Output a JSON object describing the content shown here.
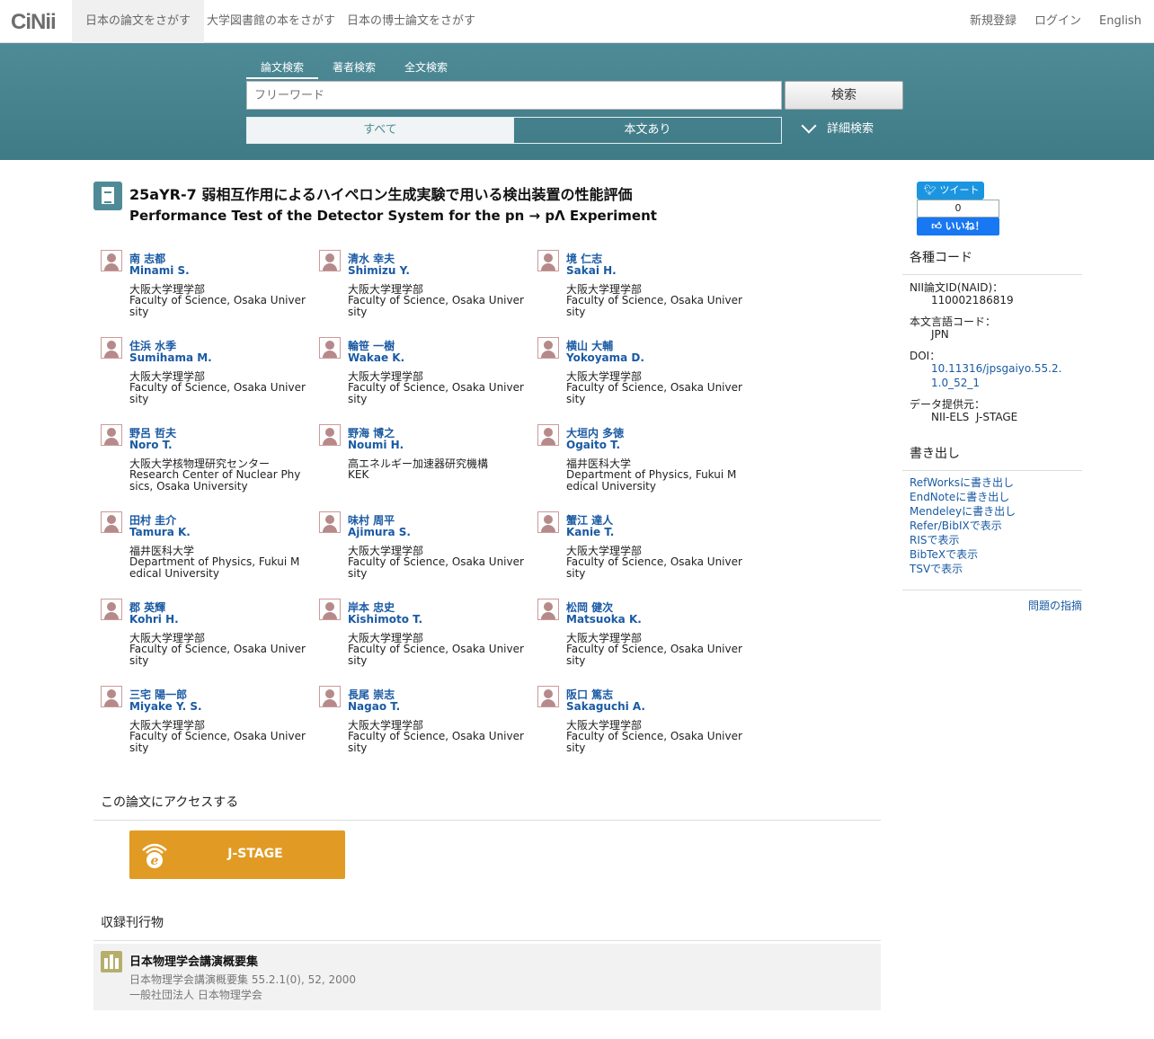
{
  "header": {
    "logo": "CiNii",
    "tabs": [
      "日本の論文をさがす",
      "大学図書館の本をさがす",
      "日本の博士論文をさがす"
    ],
    "register": "新規登録",
    "login": "ログイン",
    "language": "English"
  },
  "search": {
    "tabs": [
      "論文検索",
      "著者検索",
      "全文検索"
    ],
    "placeholder": "フリーワード",
    "button": "検索",
    "filter_all": "すべて",
    "filter_fulltext": "本文あり",
    "advanced": "詳細検索"
  },
  "article": {
    "title_ja": "25aYR-7 弱相互作用によるハイペロン生成実験で用いる検出装置の性能評価",
    "title_en": "Performance Test of the Detector System for the pn → pΛ Experiment"
  },
  "authors": [
    {
      "name": "南 志都",
      "name_en": "Minami S.",
      "aff_ja": "大阪大学理学部",
      "aff_en": "Faculty of Science, Osaka University"
    },
    {
      "name": "清水 幸夫",
      "name_en": "Shimizu Y.",
      "aff_ja": "大阪大学理学部",
      "aff_en": "Faculty of Science, Osaka University"
    },
    {
      "name": "境 仁志",
      "name_en": "Sakai H.",
      "aff_ja": "大阪大学理学部",
      "aff_en": "Faculty of Science, Osaka University"
    },
    {
      "name": "住浜 水季",
      "name_en": "Sumihama M.",
      "aff_ja": "大阪大学理学部",
      "aff_en": "Faculty of Science, Osaka University"
    },
    {
      "name": "輪笹 一樹",
      "name_en": "Wakae K.",
      "aff_ja": "大阪大学理学部",
      "aff_en": "Faculty of Science, Osaka University"
    },
    {
      "name": "横山 大輔",
      "name_en": "Yokoyama D.",
      "aff_ja": "大阪大学理学部",
      "aff_en": "Faculty of Science, Osaka University"
    },
    {
      "name": "野呂 哲夫",
      "name_en": "Noro T.",
      "aff_ja": "大阪大学核物理研究センター",
      "aff_en": "Research Center of Nuclear Physics, Osaka University"
    },
    {
      "name": "野海 博之",
      "name_en": "Noumi H.",
      "aff_ja": "高エネルギー加速器研究機構",
      "aff_en": "KEK"
    },
    {
      "name": "大垣内 多徳",
      "name_en": "Ogaito T.",
      "aff_ja": "福井医科大学",
      "aff_en": "Department of Physics, Fukui Medical University"
    },
    {
      "name": "田村 圭介",
      "name_en": "Tamura K.",
      "aff_ja": "福井医科大学",
      "aff_en": "Department of Physics, Fukui Medical University"
    },
    {
      "name": "味村 周平",
      "name_en": "Ajimura S.",
      "aff_ja": "大阪大学理学部",
      "aff_en": "Faculty of Science, Osaka University"
    },
    {
      "name": "蟹江 達人",
      "name_en": "Kanie T.",
      "aff_ja": "大阪大学理学部",
      "aff_en": "Faculty of Science, Osaka University"
    },
    {
      "name": "郡 英輝",
      "name_en": "Kohri H.",
      "aff_ja": "大阪大学理学部",
      "aff_en": "Faculty of Science, Osaka University"
    },
    {
      "name": "岸本 忠史",
      "name_en": "Kishimoto T.",
      "aff_ja": "大阪大学理学部",
      "aff_en": "Faculty of Science, Osaka University"
    },
    {
      "name": "松岡 健次",
      "name_en": "Matsuoka K.",
      "aff_ja": "大阪大学理学部",
      "aff_en": "Faculty of Science, Osaka University"
    },
    {
      "name": "三宅 陽一郎",
      "name_en": "Miyake Y. S.",
      "aff_ja": "大阪大学理学部",
      "aff_en": "Faculty of Science, Osaka University"
    },
    {
      "name": "長尾 崇志",
      "name_en": "Nagao T.",
      "aff_ja": "大阪大学理学部",
      "aff_en": "Faculty of Science, Osaka University"
    },
    {
      "name": "阪口 篤志",
      "name_en": "Sakaguchi A.",
      "aff_ja": "大阪大学理学部",
      "aff_en": "Faculty of Science, Osaka University"
    }
  ],
  "access": {
    "heading": "この論文にアクセスする",
    "jstage_label": "J-STAGE"
  },
  "journal": {
    "heading": "収録刊行物",
    "title": "日本物理学会講演概要集",
    "citation": "日本物理学会講演概要集 55.2.1(0), 52, 2000",
    "publisher": "一般社団法人 日本物理学会"
  },
  "sidebar": {
    "tweet": "ツイート",
    "like_count": "0",
    "like": "いいね！",
    "codes_heading": "各種コード",
    "naid_label": "NII論文ID(NAID)：",
    "naid": "110002186819",
    "lang_label": "本文言語コード：",
    "lang": "JPN",
    "doi_label": "DOI：",
    "doi": "10.11316/jpsgaiyo.55.2.1.0_52_1",
    "provider_label": "データ提供元：",
    "provider": "NII-ELS  J-STAGE",
    "export_heading": "書き出し",
    "exports": [
      "RefWorksに書き出し",
      "EndNoteに書き出し",
      "Mendeleyに書き出し",
      "Refer/BibIXで表示",
      "RISで表示",
      "BibTeXで表示",
      "TSVで表示"
    ],
    "report": "問題の指摘"
  }
}
